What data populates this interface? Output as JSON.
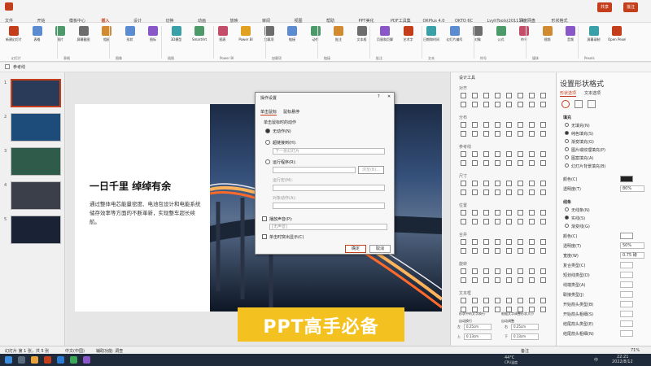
{
  "menu": {
    "tabs": [
      "文件",
      "开始",
      "模板中心",
      "插入",
      "设计",
      "切换",
      "动画",
      "放映",
      "审阅",
      "视图",
      "帮助",
      "PPT美化",
      "PDF工具集",
      "OKPlus 4.0",
      "OKTO 6C",
      "LvyhTools(201114)",
      "百度网盘",
      "形状格式"
    ],
    "active_tab": "插入",
    "share_label": "共享",
    "comment_label": "批注"
  },
  "ribbon": {
    "buttons": [
      "新建幻灯片",
      "表格",
      "图片",
      "屏幕截图",
      "相册",
      "形状",
      "图标",
      "3D模型",
      "SmartArt",
      "图表",
      "Power BI",
      "加载项",
      "链接",
      "动作",
      "批注",
      "文本框",
      "页眉和页脚",
      "艺术字",
      "日期和时间",
      "幻灯片编号",
      "对象",
      "公式",
      "符号",
      "视频",
      "音频",
      "屏幕录制",
      "Open Pexels"
    ],
    "groups": [
      "幻灯片",
      "表格",
      "图像",
      "插图",
      "Power BI",
      "加载项",
      "链接",
      "批注",
      "文本",
      "符号",
      "媒体",
      "Pexels"
    ]
  },
  "quickbar": {
    "label": "参考线"
  },
  "thumbnails": [
    "1",
    "2",
    "3",
    "4",
    "5"
  ],
  "slide": {
    "heading": "一日千里 绰绰有余",
    "body": "通过整体电芯能量密度、电池包设计和电能系统储存效率等方面的不断革新，实现整车超长续航。",
    "banner": "PPT高手必备"
  },
  "dialog": {
    "title": "操作设置",
    "tabs": [
      "单击鼠标",
      "鼠标悬停"
    ],
    "section": "单击鼠标时的动作",
    "options": [
      "无动作(N)",
      "超链接到(H):",
      "运行程序(R):",
      "运行宏(M):",
      "对象动作(A):"
    ],
    "link_placeholder": "下一张幻灯片",
    "browse": "浏览(B)...",
    "play_sound": "播放声音(P):",
    "sound_value": "[无声音]",
    "highlight": "单击时突出显示(C)",
    "ok": "确定",
    "cancel": "取消"
  },
  "tools_panel": {
    "title": "设计工具",
    "sections": [
      "对齐",
      "分布",
      "参考线",
      "尺寸",
      "位置",
      "合并",
      "旋转",
      "文本框"
    ],
    "text_opts": [
      "形状中的文字换行",
      "根据文字调整形状大小",
      "自动换行",
      "自动调整"
    ],
    "margins": [
      "0.25cm",
      "0.25cm",
      "0.13cm",
      "0.13cm"
    ],
    "margin_labels": [
      "左",
      "右",
      "上",
      "下"
    ]
  },
  "props_panel": {
    "title": "设置形状格式",
    "tabs": [
      "形状选项",
      "文本选项"
    ],
    "fill_section": "填充",
    "fill_opts": [
      "无填充(N)",
      "纯色填充(S)",
      "渐变填充(G)",
      "图片或纹理填充(P)",
      "图案填充(A)",
      "幻灯片背景填充(B)"
    ],
    "color_label": "颜色(C)",
    "transparency_label": "透明度(T)",
    "transparency_value": "80%",
    "line_section": "线条",
    "line_opts": [
      "无线条(N)",
      "实线(S)",
      "渐变线(G)"
    ],
    "line_color": "颜色(C)",
    "line_trans": "透明度(T)",
    "line_trans_value": "50%",
    "width_label": "宽度(W)",
    "width_value": "0.75 磅",
    "extra": [
      "复合类型(C)",
      "短划线类型(D)",
      "线端类型(A)",
      "联接类型(J)",
      "开始箭头类型(B)",
      "开始箭头粗细(S)",
      "结尾箭头类型(E)",
      "结尾箭头粗细(N)"
    ]
  },
  "status": {
    "left": "幻灯片 第 1 张，共 5 张",
    "lang": "中文(中国)",
    "access": "辅助功能: 调查",
    "notes": "备注",
    "zoom": "71%"
  },
  "taskbar": {
    "temp": "44°C",
    "cpu": "CPU温度",
    "time": "22:21",
    "date": "2022/8/12",
    "lang": "中"
  },
  "colors": {
    "accent": "#c43e1c",
    "banner_bg": "#f4c220",
    "banner_fg": "#ffffff",
    "taskbar": "#1f2a3a"
  }
}
